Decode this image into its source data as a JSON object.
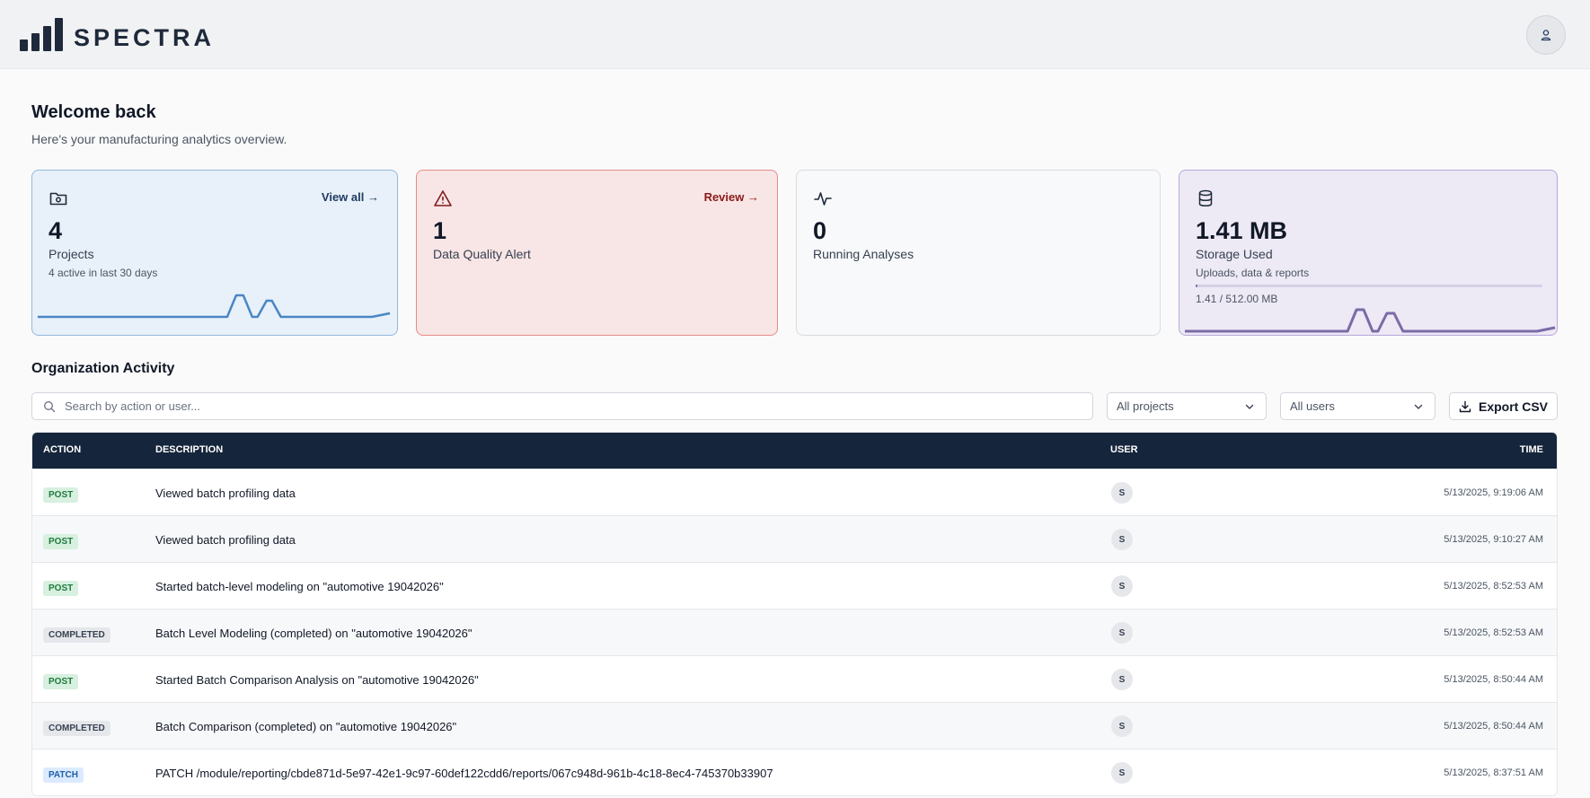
{
  "brand": {
    "name": "SPECTRA",
    "color": "#1e2a3b"
  },
  "header": {
    "avatar_icon": "user-icon"
  },
  "welcome": {
    "title": "Welcome back",
    "subtitle": "Here's your manufacturing analytics overview."
  },
  "cards": {
    "projects": {
      "icon": "folder-icon",
      "value": "4",
      "label": "Projects",
      "sub": "4 active in last 30 days",
      "link": "View all",
      "color": "#4a86c4"
    },
    "alert": {
      "icon": "warning-icon",
      "value": "1",
      "label": "Data Quality Alert",
      "link": "Review",
      "color": "#8b1a1a"
    },
    "running": {
      "icon": "activity-icon",
      "value": "0",
      "label": "Running Analyses"
    },
    "storage": {
      "icon": "database-icon",
      "value": "1.41 MB",
      "label": "Storage Used",
      "sub": "Uploads, data & reports",
      "usage": "1.41 / 512.00 MB",
      "usage_fraction": 0.0028,
      "color": "#7c6aa8"
    }
  },
  "activity": {
    "title": "Organization Activity",
    "search_placeholder": "Search by action or user...",
    "filter_projects": "All projects",
    "filter_users": "All users",
    "export_label": "Export CSV",
    "columns": {
      "action": "ACTION",
      "description": "DESCRIPTION",
      "user": "USER",
      "time": "TIME"
    },
    "rows": [
      {
        "action": "POST",
        "kind": "post",
        "description": "Viewed batch profiling data",
        "user": "S",
        "time": "5/13/2025, 9:19:06 AM"
      },
      {
        "action": "POST",
        "kind": "post",
        "description": "Viewed batch profiling data",
        "user": "S",
        "time": "5/13/2025, 9:10:27 AM"
      },
      {
        "action": "POST",
        "kind": "post",
        "description": "Started batch-level modeling on \"automotive 19042026\"",
        "user": "S",
        "time": "5/13/2025, 8:52:53 AM"
      },
      {
        "action": "COMPLETED",
        "kind": "completed",
        "description": "Batch Level Modeling (completed) on \"automotive 19042026\"",
        "user": "S",
        "time": "5/13/2025, 8:52:53 AM"
      },
      {
        "action": "POST",
        "kind": "post",
        "description": "Started Batch Comparison Analysis on \"automotive 19042026\"",
        "user": "S",
        "time": "5/13/2025, 8:50:44 AM"
      },
      {
        "action": "COMPLETED",
        "kind": "completed",
        "description": "Batch Comparison (completed) on \"automotive 19042026\"",
        "user": "S",
        "time": "5/13/2025, 8:50:44 AM"
      },
      {
        "action": "PATCH",
        "kind": "patch",
        "description": "PATCH /module/reporting/cbde871d-5e97-42e1-9c97-60def122cdd6/reports/067c948d-961b-4c18-8ec4-745370b33907",
        "user": "S",
        "time": "5/13/2025, 8:37:51 AM"
      }
    ]
  }
}
